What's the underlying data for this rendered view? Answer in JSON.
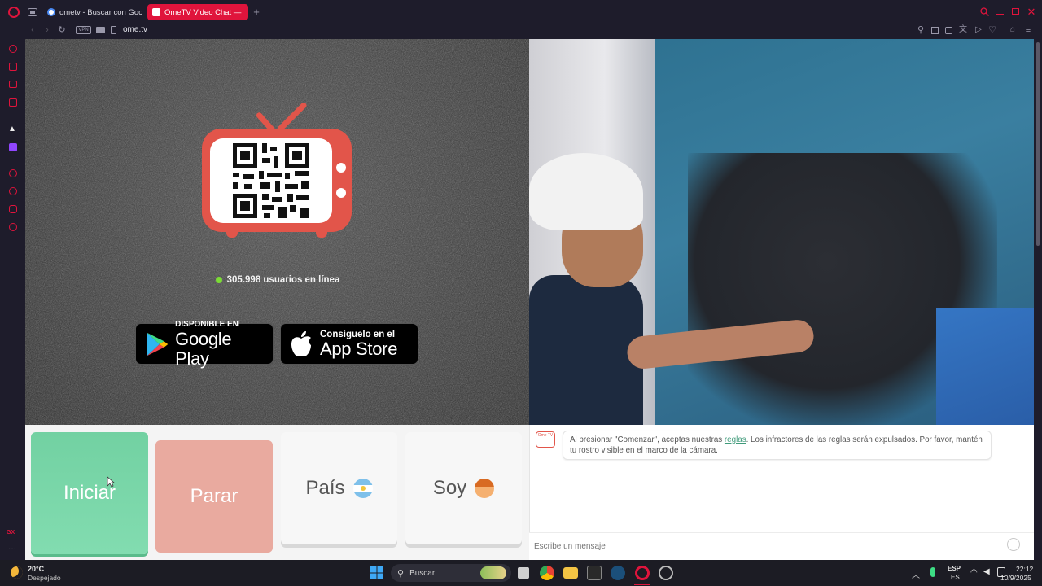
{
  "browser": {
    "tabs": [
      {
        "label": "ometv - Buscar con Goog"
      },
      {
        "label": "OmeTV Video Chat —"
      }
    ],
    "new_tab_symbol": "+",
    "address": "ome.tv",
    "vpn_label": "VPN",
    "accent": "#e0143c"
  },
  "left_panel": {
    "online_count": "305.998 usuarios en línea",
    "google_play": {
      "small": "DISPONIBLE EN",
      "big": "Google Play"
    },
    "app_store": {
      "small": "Consíguelo en el",
      "big": "App Store"
    }
  },
  "controls": {
    "start": "Iniciar",
    "stop": "Parar",
    "country": "País",
    "gender": "Soy"
  },
  "chat": {
    "bot_avatar_text": "Ome TV",
    "message_before": "Al presionar \"Comenzar\", aceptas nuestras ",
    "message_link": "reglas",
    "message_after": ". Los infractores de las reglas serán expulsados. Por favor, mantén tu rostro visible en el marco de la cámara.",
    "input_placeholder": "Escribe un mensaje"
  },
  "sidebar": {
    "bottom_label": "GX"
  },
  "taskbar": {
    "weather_temp": "20°C",
    "weather_desc": "Despejado",
    "search_label": "Buscar",
    "lang_top": "ESP",
    "lang_bottom": "ES",
    "time": "22:12",
    "date": "10/9/2025"
  }
}
